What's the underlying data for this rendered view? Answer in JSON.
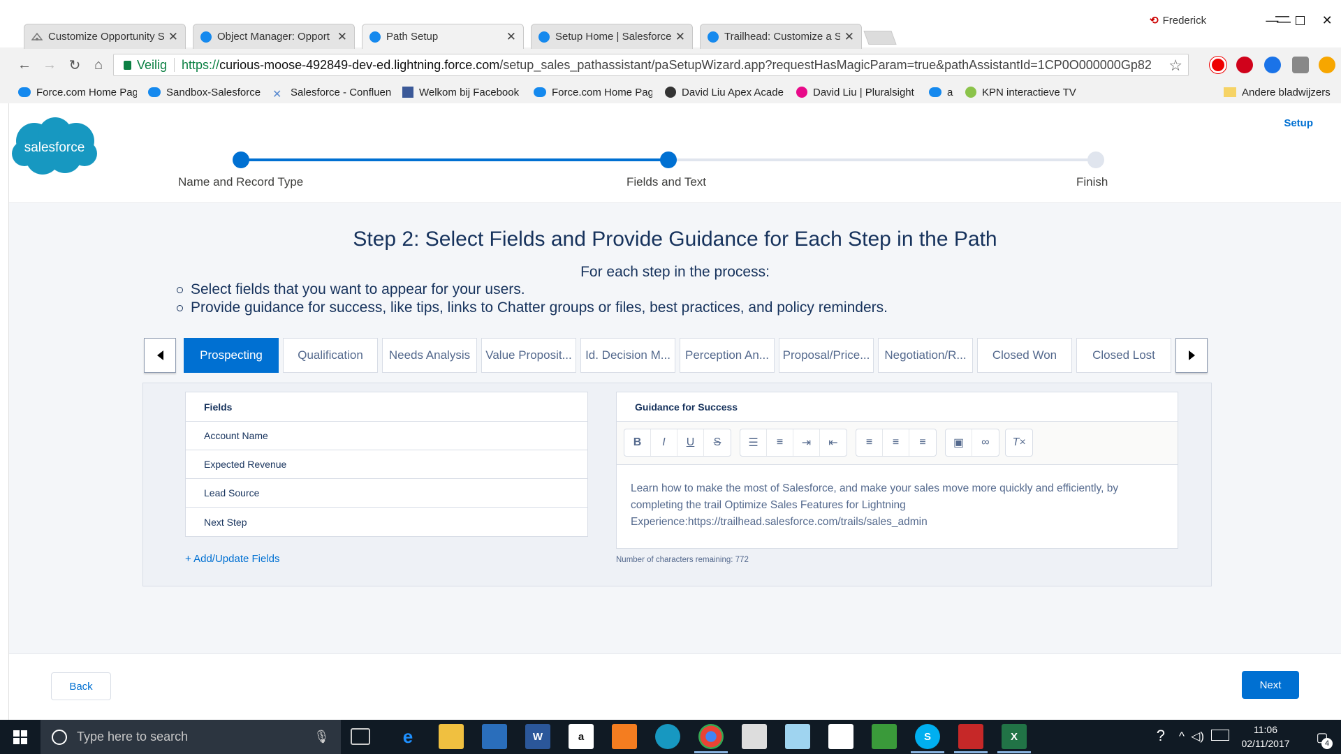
{
  "colors": {
    "brand_blue": "#0070d2",
    "sf_cloud": "#1798c1",
    "text_dark": "#16325c",
    "text_muted": "#54698d"
  },
  "browser": {
    "profile_name": "Frederick",
    "tabs": [
      {
        "title": "Customize Opportunity S",
        "icon": "trailhead-icon",
        "active": false
      },
      {
        "title": "Object Manager: Opport",
        "icon": "salesforce-cloud-icon",
        "active": false
      },
      {
        "title": "Path Setup",
        "icon": "salesforce-cloud-icon",
        "active": true
      },
      {
        "title": "Setup Home | Salesforce",
        "icon": "salesforce-cloud-icon",
        "active": false
      },
      {
        "title": "Trailhead: Customize a Sa",
        "icon": "salesforce-cloud-icon",
        "active": false
      }
    ],
    "secure_label": "Veilig",
    "url_scheme": "https://",
    "url_host": "curious-moose-492849-dev-ed.lightning.force.com",
    "url_path": "/setup_sales_pathassistant/paSetupWizard.app?requestHasMagicParam=true&pathAssistantId=1CP0O000000Gp82",
    "bookmarks": [
      {
        "label": "Force.com Home Pag",
        "icon": "salesforce-cloud-icon"
      },
      {
        "label": "Sandbox-Salesforce",
        "icon": "salesforce-cloud-icon"
      },
      {
        "label": "Salesforce - Confluen",
        "icon": "confluence-icon"
      },
      {
        "label": "Welkom bij Facebook",
        "icon": "facebook-icon"
      },
      {
        "label": "Force.com Home Pag",
        "icon": "salesforce-cloud-icon"
      },
      {
        "label": "David Liu Apex Acade",
        "icon": "academy-icon"
      },
      {
        "label": "David Liu | Pluralsight",
        "icon": "pluralsight-icon"
      },
      {
        "label": "a",
        "icon": "salesforce-cloud-icon"
      },
      {
        "label": "KPN interactieve TV",
        "icon": "kpn-icon"
      }
    ],
    "other_bookmarks": "Andere bladwijzers"
  },
  "header": {
    "logo_text": "salesforce",
    "setup_link": "Setup"
  },
  "progress": {
    "steps": [
      {
        "label": "Name and Record Type",
        "state": "complete"
      },
      {
        "label": "Fields and Text",
        "state": "current"
      },
      {
        "label": "Finish",
        "state": "incomplete"
      }
    ]
  },
  "main": {
    "title": "Step 2: Select Fields and Provide Guidance for Each Step in the Path",
    "subtitle": "For each step in the process:",
    "bullets": [
      "Select fields that you want to appear for your users.",
      "Provide guidance for success, like tips, links to Chatter groups or files, best practices, and policy reminders."
    ]
  },
  "stages": [
    {
      "label": "Prospecting",
      "active": true
    },
    {
      "label": "Qualification",
      "active": false
    },
    {
      "label": "Needs Analysis",
      "active": false
    },
    {
      "label": "Value Proposit...",
      "active": false
    },
    {
      "label": "Id. Decision M...",
      "active": false
    },
    {
      "label": "Perception An...",
      "active": false
    },
    {
      "label": "Proposal/Price...",
      "active": false
    },
    {
      "label": "Negotiation/R...",
      "active": false
    },
    {
      "label": "Closed Won",
      "active": false
    },
    {
      "label": "Closed Lost",
      "active": false
    }
  ],
  "fields_panel": {
    "header": "Fields",
    "items": [
      "Account Name",
      "Expected Revenue",
      "Lead Source",
      "Next Step"
    ],
    "add_link": "+ Add/Update Fields"
  },
  "guidance_panel": {
    "header": "Guidance for Success",
    "text": "Learn how to make the most of Salesforce, and make your sales move more quickly and efficiently, by completing the trail Optimize Sales Features for Lightning Experience:https://trailhead.salesforce.com/trails/sales_admin",
    "chars_remaining": "Number of characters remaining: 772"
  },
  "footer": {
    "back_label": "Back",
    "next_label": "Next"
  },
  "taskbar": {
    "search_placeholder": "Type here to search",
    "time": "11:06",
    "date": "02/11/2017",
    "notification_count": "4"
  }
}
